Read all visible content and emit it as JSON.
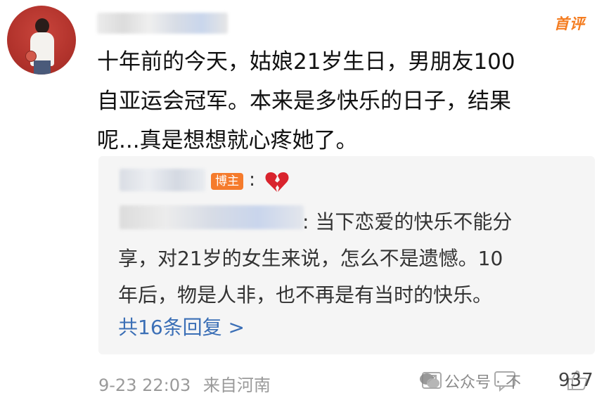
{
  "comment": {
    "badge": "首评",
    "lines": [
      "十年前的今天，姑娘21岁生日，男朋友100",
      "自亚运会冠军。本来是多快乐的日子，结果",
      "呢...真是想想就心疼她了。"
    ],
    "timestamp": "9-23 22:03",
    "location": "来自河南",
    "like_count": "937"
  },
  "reply": {
    "author_badge": "博主",
    "author_colon": ":",
    "author_emoji": "💔",
    "lines": [
      ": 当下恋爱的快乐不能分",
      "享，对21岁的女生来说，怎么不是遗憾。10",
      "年后，物是人非，也不再是有当时的快乐。"
    ],
    "view_more": "共16条回复 >"
  },
  "watermark": {
    "text": "公众号 · 不"
  },
  "colors": {
    "badge_orange": "#f57b2c",
    "link_blue": "#3b6fb6"
  }
}
